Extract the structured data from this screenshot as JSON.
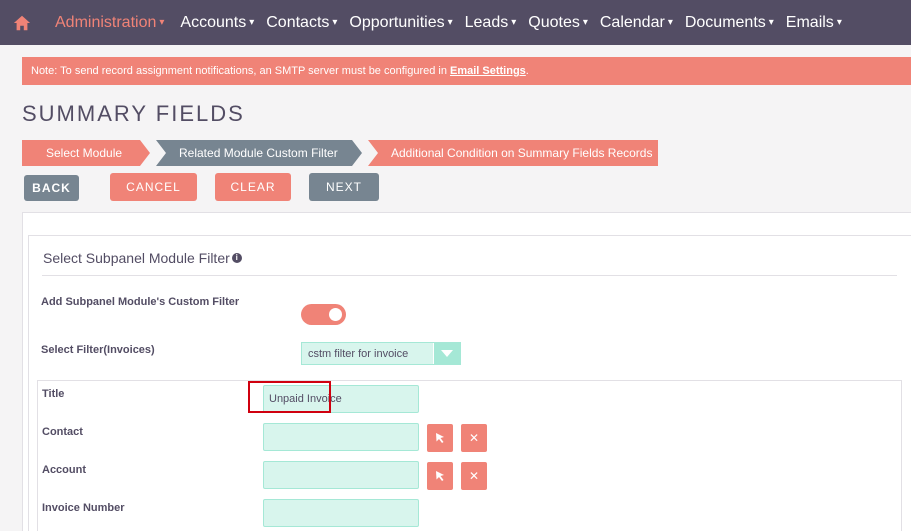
{
  "nav": {
    "items": [
      {
        "label": "Administration",
        "active": true
      },
      {
        "label": "Accounts"
      },
      {
        "label": "Contacts"
      },
      {
        "label": "Opportunities"
      },
      {
        "label": "Leads"
      },
      {
        "label": "Quotes"
      },
      {
        "label": "Calendar"
      },
      {
        "label": "Documents"
      },
      {
        "label": "Emails"
      }
    ],
    "home_icon": "home-icon"
  },
  "notice": {
    "text": "Note: To send record assignment notifications, an SMTP server must be configured in",
    "link": "Email Settings",
    "suffix": "."
  },
  "page_title": "SUMMARY FIELDS",
  "steps": [
    "Select Module",
    "Related Module Custom Filter",
    "Additional Condition on Summary Fields Records"
  ],
  "buttons": {
    "back": "BACK",
    "cancel": "CANCEL",
    "clear": "CLEAR",
    "next": "NEXT"
  },
  "subpanel": {
    "title": "Select Subpanel Module Filter",
    "custom_filter_label": "Add Subpanel Module's Custom Filter",
    "custom_filter_enabled": true,
    "select_filter_label": "Select Filter(Invoices)",
    "select_filter_value": "cstm filter for invoice"
  },
  "fields": {
    "title": {
      "label": "Title",
      "value": "Unpaid Invoice"
    },
    "contact": {
      "label": "Contact",
      "value": ""
    },
    "account": {
      "label": "Account",
      "value": ""
    },
    "invoice_number": {
      "label": "Invoice Number",
      "value": ""
    }
  },
  "colors": {
    "accent": "#f08377",
    "nav_bg": "#534d64",
    "secondary": "#778591",
    "field_bg": "#d8f5ed",
    "highlight": "#d0000f"
  }
}
